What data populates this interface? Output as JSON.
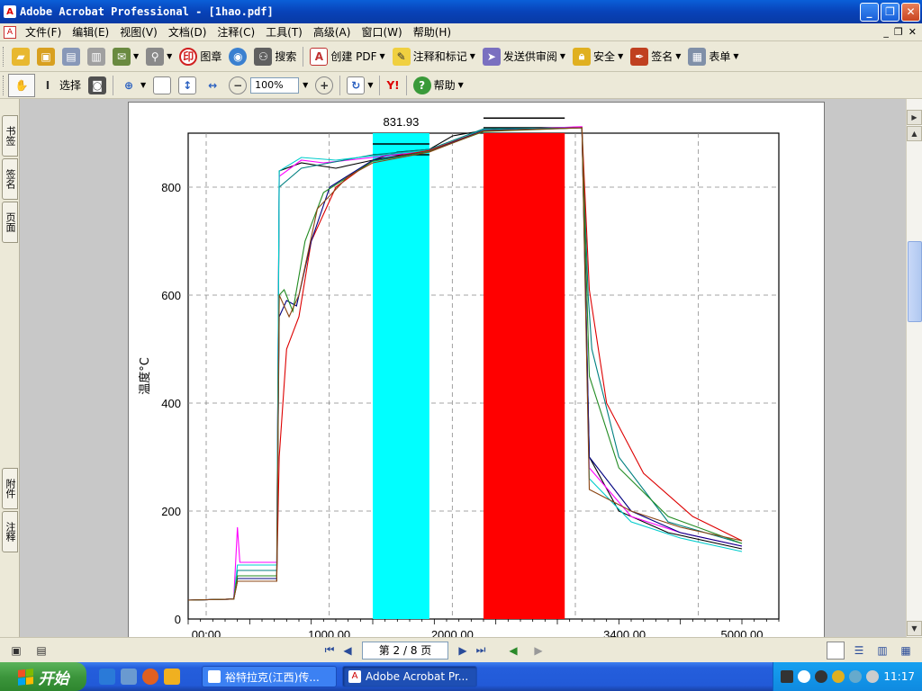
{
  "window": {
    "title": "Adobe Acrobat Professional - [1hao.pdf]"
  },
  "menu": [
    "文件(F)",
    "编辑(E)",
    "视图(V)",
    "文档(D)",
    "注释(C)",
    "工具(T)",
    "高级(A)",
    "窗口(W)",
    "帮助(H)"
  ],
  "toolbar1": {
    "stamp_label": "图章",
    "search_label": "搜索",
    "create_pdf_label": "创建 PDF",
    "comment_label": "注释和标记",
    "send_review_label": "发送供审阅",
    "security_label": "安全",
    "sign_label": "签名",
    "forms_label": "表单"
  },
  "toolbar2": {
    "select_label": "选择",
    "zoom_value": "100%",
    "help_label": "帮助"
  },
  "side_tabs": [
    "书签",
    "签名",
    "页面",
    "附件",
    "注释"
  ],
  "status": {
    "page_display": "第 2 / 8 页"
  },
  "taskbar": {
    "start_label": "开始",
    "items": [
      "裕特拉克(江西)传...",
      "Adobe Acrobat Pr..."
    ],
    "clock": "11:17"
  },
  "colors": {
    "cyan_band": "#00ffff",
    "red_band": "#ff0000",
    "title_blue": "#0a5fd8"
  },
  "chart_data": {
    "type": "line",
    "ylabel": "温度°C",
    "ylim": [
      0,
      900
    ],
    "yticks": [
      0,
      200,
      400,
      600,
      800
    ],
    "xticks_note": "x tick labels partially cut off at page bottom",
    "xticks": [
      "00:00",
      "1000.00",
      "2000.00",
      "3400.00",
      "5000.00"
    ],
    "xlim": [
      0,
      4800
    ],
    "grid": true,
    "annotation": "831.93",
    "bands": [
      {
        "color": "cyan",
        "x": [
          1500,
          1960
        ],
        "lines": [
          880,
          860
        ]
      },
      {
        "color": "red",
        "x": [
          2400,
          3060
        ],
        "lines": [
          928,
          910
        ]
      }
    ],
    "series": [
      {
        "color": "#000000",
        "points": [
          [
            0,
            35
          ],
          [
            370,
            37
          ],
          [
            400,
            70
          ],
          [
            720,
            70
          ],
          [
            740,
            830
          ],
          [
            920,
            845
          ],
          [
            1200,
            835
          ],
          [
            1500,
            850
          ],
          [
            1700,
            865
          ],
          [
            1960,
            870
          ],
          [
            2150,
            895
          ],
          [
            2400,
            905
          ],
          [
            2700,
            910
          ],
          [
            3200,
            910
          ],
          [
            3260,
            300
          ],
          [
            3500,
            200
          ],
          [
            3900,
            160
          ],
          [
            4500,
            130
          ]
        ]
      },
      {
        "color": "#ff00ff",
        "points": [
          [
            0,
            35
          ],
          [
            370,
            37
          ],
          [
            400,
            170
          ],
          [
            420,
            105
          ],
          [
            720,
            105
          ],
          [
            740,
            820
          ],
          [
            920,
            850
          ],
          [
            1100,
            845
          ],
          [
            1500,
            855
          ],
          [
            1960,
            868
          ],
          [
            2400,
            905
          ],
          [
            3200,
            912
          ],
          [
            3260,
            280
          ],
          [
            3600,
            190
          ],
          [
            4000,
            160
          ],
          [
            4500,
            135
          ]
        ]
      },
      {
        "color": "#008080",
        "points": [
          [
            0,
            35
          ],
          [
            370,
            37
          ],
          [
            400,
            90
          ],
          [
            720,
            90
          ],
          [
            740,
            800
          ],
          [
            920,
            835
          ],
          [
            1150,
            845
          ],
          [
            1500,
            860
          ],
          [
            1960,
            870
          ],
          [
            2400,
            908
          ],
          [
            3200,
            910
          ],
          [
            3250,
            600
          ],
          [
            3280,
            500
          ],
          [
            3500,
            300
          ],
          [
            3900,
            180
          ],
          [
            4500,
            140
          ]
        ]
      },
      {
        "color": "#00cccc",
        "points": [
          [
            0,
            35
          ],
          [
            370,
            37
          ],
          [
            400,
            100
          ],
          [
            720,
            100
          ],
          [
            740,
            830
          ],
          [
            920,
            855
          ],
          [
            1200,
            850
          ],
          [
            1500,
            858
          ],
          [
            1960,
            868
          ],
          [
            2400,
            906
          ],
          [
            3200,
            910
          ],
          [
            3260,
            260
          ],
          [
            3600,
            180
          ],
          [
            4000,
            150
          ],
          [
            4500,
            125
          ]
        ]
      },
      {
        "color": "#dd0000",
        "points": [
          [
            0,
            35
          ],
          [
            370,
            37
          ],
          [
            400,
            80
          ],
          [
            720,
            80
          ],
          [
            740,
            300
          ],
          [
            800,
            500
          ],
          [
            900,
            560
          ],
          [
            1000,
            700
          ],
          [
            1200,
            800
          ],
          [
            1500,
            850
          ],
          [
            1960,
            868
          ],
          [
            2400,
            905
          ],
          [
            3200,
            910
          ],
          [
            3260,
            610
          ],
          [
            3400,
            400
          ],
          [
            3700,
            270
          ],
          [
            4100,
            190
          ],
          [
            4500,
            145
          ]
        ]
      },
      {
        "color": "#000080",
        "points": [
          [
            0,
            35
          ],
          [
            370,
            37
          ],
          [
            400,
            75
          ],
          [
            720,
            75
          ],
          [
            740,
            560
          ],
          [
            800,
            590
          ],
          [
            880,
            580
          ],
          [
            1000,
            700
          ],
          [
            1150,
            800
          ],
          [
            1500,
            850
          ],
          [
            1960,
            866
          ],
          [
            2400,
            905
          ],
          [
            3200,
            910
          ],
          [
            3260,
            300
          ],
          [
            3600,
            200
          ],
          [
            4000,
            160
          ],
          [
            4500,
            135
          ]
        ]
      },
      {
        "color": "#228b22",
        "points": [
          [
            0,
            35
          ],
          [
            370,
            37
          ],
          [
            400,
            80
          ],
          [
            720,
            80
          ],
          [
            740,
            600
          ],
          [
            780,
            610
          ],
          [
            850,
            570
          ],
          [
            950,
            700
          ],
          [
            1100,
            790
          ],
          [
            1500,
            848
          ],
          [
            1960,
            866
          ],
          [
            2400,
            903
          ],
          [
            3200,
            910
          ],
          [
            3260,
            450
          ],
          [
            3500,
            280
          ],
          [
            3900,
            190
          ],
          [
            4500,
            140
          ]
        ]
      },
      {
        "color": "#8b4513",
        "points": [
          [
            0,
            35
          ],
          [
            370,
            37
          ],
          [
            400,
            70
          ],
          [
            720,
            70
          ],
          [
            740,
            600
          ],
          [
            820,
            560
          ],
          [
            900,
            600
          ],
          [
            1050,
            760
          ],
          [
            1300,
            820
          ],
          [
            1500,
            845
          ],
          [
            1960,
            865
          ],
          [
            2400,
            904
          ],
          [
            3200,
            910
          ],
          [
            3260,
            240
          ],
          [
            3600,
            200
          ],
          [
            4000,
            170
          ],
          [
            4500,
            145
          ]
        ]
      }
    ]
  }
}
